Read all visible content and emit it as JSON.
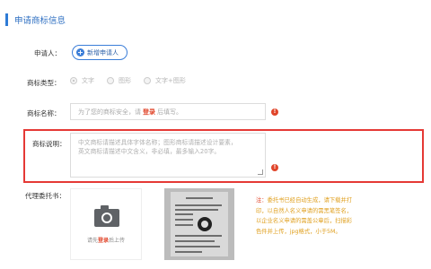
{
  "section": {
    "title": "申请商标信息"
  },
  "applicant": {
    "label": "申请人：",
    "add_button": "新增申请人"
  },
  "trademark_type": {
    "label": "商标类型：",
    "options": [
      "文字",
      "图形",
      "文字+图形"
    ],
    "selected": "文字"
  },
  "trademark_name": {
    "label": "商标名称：",
    "placeholder_before": "为了您的商标安全，请",
    "placeholder_link": "登录",
    "placeholder_after": "后填写。"
  },
  "trademark_desc": {
    "label": "商标说明：",
    "placeholder_line1": "中文商标请描述具体字体名称；图形商标请描述设计要素，",
    "placeholder_line2": "英文商标请描述中文含义，非必填，最多输入20字。"
  },
  "power_of_attorney": {
    "label": "代理委托书：",
    "upload_before": "请先",
    "upload_link": "登录",
    "upload_after": "后上传",
    "note_prefix": "注：",
    "note_body": "委托书已经自动生成，请下载并打印，以自然人名义申请的需黑笔签名，以企业名义申请的需盖公章后，扫描彩色件并上传，jpg格式，小于5M。"
  },
  "colors": {
    "accent": "#2e7bd6",
    "error": "#e0452a",
    "highlight": "#e53935",
    "note": "#e0a020"
  },
  "icons": {
    "add": "plus-circle-icon",
    "error": "exclamation-circle-icon",
    "upload": "camera-icon"
  }
}
